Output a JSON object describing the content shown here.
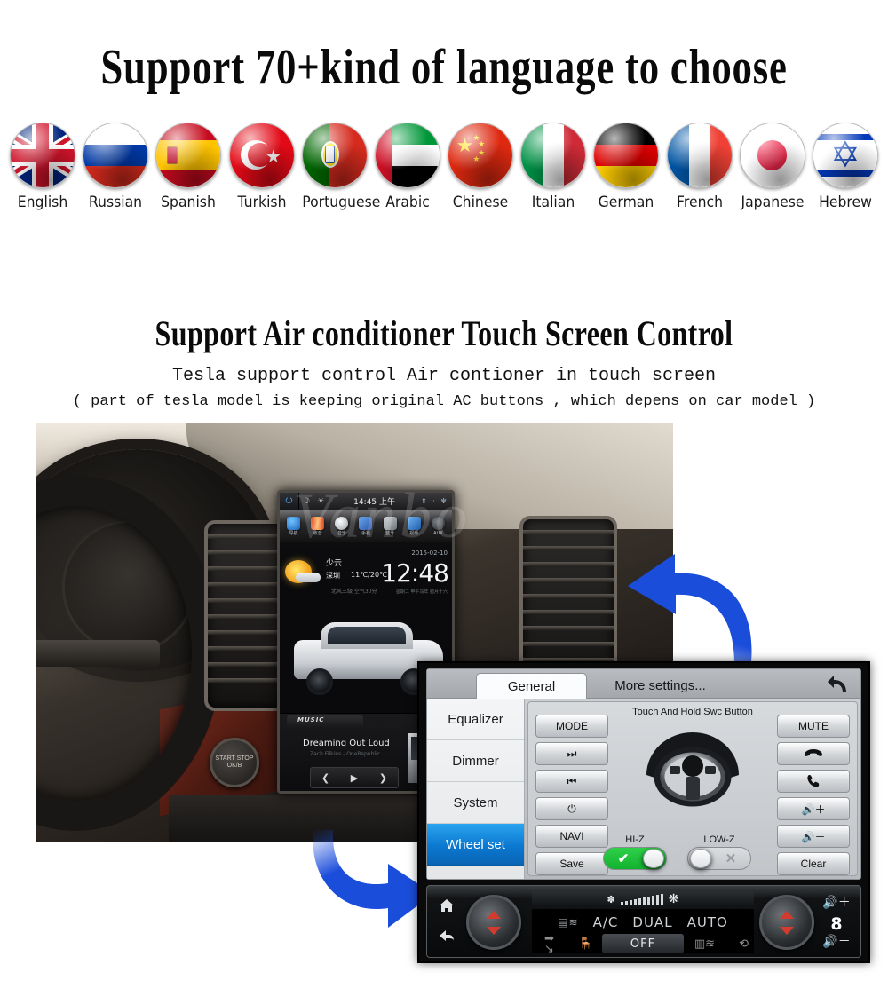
{
  "headings": {
    "title_languages": "Support 70+kind of  language to choose",
    "title_ac": "Support Air conditioner Touch Screen Control",
    "sub_ac_1": "Tesla support control Air contioner in touch screen",
    "sub_ac_2": "( part of tesla model is keeping original AC buttons , which depens on car model )"
  },
  "languages": [
    {
      "label": "English",
      "flag": "uk-flag-icon"
    },
    {
      "label": "Russian",
      "flag": "russia-flag-icon"
    },
    {
      "label": "Spanish",
      "flag": "spain-flag-icon"
    },
    {
      "label": "Turkish",
      "flag": "turkey-flag-icon"
    },
    {
      "label": "Portuguese",
      "flag": "portugal-flag-icon"
    },
    {
      "label": "Arabic",
      "flag": "uae-flag-icon"
    },
    {
      "label": "Chinese",
      "flag": "china-flag-icon"
    },
    {
      "label": "Italian",
      "flag": "italy-flag-icon"
    },
    {
      "label": "German",
      "flag": "germany-flag-icon"
    },
    {
      "label": "French",
      "flag": "france-flag-icon"
    },
    {
      "label": "Japanese",
      "flag": "japan-flag-icon"
    },
    {
      "label": "Hebrew",
      "flag": "israel-flag-icon"
    }
  ],
  "head_unit": {
    "status": {
      "power_icon": "power-icon",
      "night_icon": "moon-icon",
      "brightness_icon": "brightness-icon",
      "time": "14:45 上午",
      "right_icons": "⬆ · ✻"
    },
    "apps": [
      {
        "label": "导航",
        "icon": "navigation-icon",
        "color": "#2b7fd6"
      },
      {
        "label": "收音",
        "icon": "radio-icon",
        "color": "#d6452b"
      },
      {
        "label": "音乐",
        "icon": "music-icon",
        "color": "#cfd2d5"
      },
      {
        "label": "手机",
        "icon": "phone-icon",
        "color": "#3a6fd0"
      },
      {
        "label": "蓝牙",
        "icon": "bluetooth-icon",
        "color": "#8b8f93"
      },
      {
        "label": "视频",
        "icon": "video-icon",
        "color": "#2f72c8"
      },
      {
        "label": "AUX",
        "icon": "aux-icon",
        "color": "#4a4d50"
      }
    ],
    "weather": {
      "condition": "少云",
      "city": "深圳",
      "temperature": "11℃/20℃",
      "source": "北风三级  空气30分"
    },
    "clock": "12:48",
    "date": "2015-02-10",
    "date_sub": "星期二   甲午马年  腊月十六",
    "music": {
      "tab": "MUSIC",
      "title": "Dreaming Out Loud",
      "artist": "Zach Filkins - OneRepublic",
      "prev_icon": "previous-track-icon",
      "play_icon": "play-icon",
      "next_icon": "next-track-icon"
    },
    "watermark": "Vanbo"
  },
  "car_photo": {
    "start_button_label": "START STOP  OK/B"
  },
  "settings": {
    "tabs": [
      {
        "label": "General",
        "active": true
      },
      {
        "label": "More settings...",
        "active": false
      }
    ],
    "back_icon": "back-arrow-icon",
    "side_menu": [
      {
        "label": "Equalizer",
        "selected": false
      },
      {
        "label": "Dimmer",
        "selected": false
      },
      {
        "label": "System",
        "selected": false
      },
      {
        "label": "Wheel set",
        "selected": true
      }
    ],
    "swc_hint": "Touch And Hold Swc Button",
    "left_buttons": [
      {
        "label": "MODE",
        "icon": ""
      },
      {
        "label": "",
        "icon": "next-track-icon"
      },
      {
        "label": "",
        "icon": "previous-track-icon"
      },
      {
        "label": "",
        "icon": "power-icon"
      },
      {
        "label": "NAVI",
        "icon": ""
      },
      {
        "label": "Save",
        "icon": ""
      }
    ],
    "right_buttons": [
      {
        "label": "MUTE",
        "icon": ""
      },
      {
        "label": "",
        "icon": "hang-up-icon"
      },
      {
        "label": "",
        "icon": "call-icon"
      },
      {
        "label": "",
        "icon": "volume-up-icon"
      },
      {
        "label": "",
        "icon": "volume-down-icon"
      },
      {
        "label": "Clear",
        "icon": ""
      }
    ],
    "toggles": [
      {
        "label": "HI-Z",
        "state": "on",
        "glyph": "✔"
      },
      {
        "label": "LOW-Z",
        "state": "off",
        "glyph": "✕"
      }
    ],
    "steering_wheel_icon": "steering-wheel-icon",
    "accent_selected": "#0b78d0",
    "accent_toggle_on": "#17bb33"
  },
  "ac_panel": {
    "home_icon": "home-icon",
    "back_icon": "back-arrow-icon",
    "fan_low_icon": "fan-low-icon",
    "fan_high_icon": "fan-high-icon",
    "modes": [
      "A/C",
      "DUAL",
      "AUTO"
    ],
    "defrost_icon": "front-defrost-icon",
    "max_defrost_icon": "max-defrost-icon",
    "recirculate_icon": "recirculate-icon",
    "airflow_icon": "airflow-icon",
    "seat_icon": "seat-airflow-icon",
    "off_label": "OFF",
    "volume_up_icon": "volume-up-icon",
    "volume_down_icon": "volume-down-icon",
    "volume_value": "8",
    "left_knob_icon": "temperature-knob-left",
    "right_knob_icon": "temperature-knob-right"
  },
  "arrows": [
    {
      "name": "arrow-to-head-unit",
      "direction": "up-left",
      "color": "#1b4ddb"
    },
    {
      "name": "arrow-to-ac-panel",
      "direction": "down-right",
      "color": "#1b4ddb"
    }
  ]
}
